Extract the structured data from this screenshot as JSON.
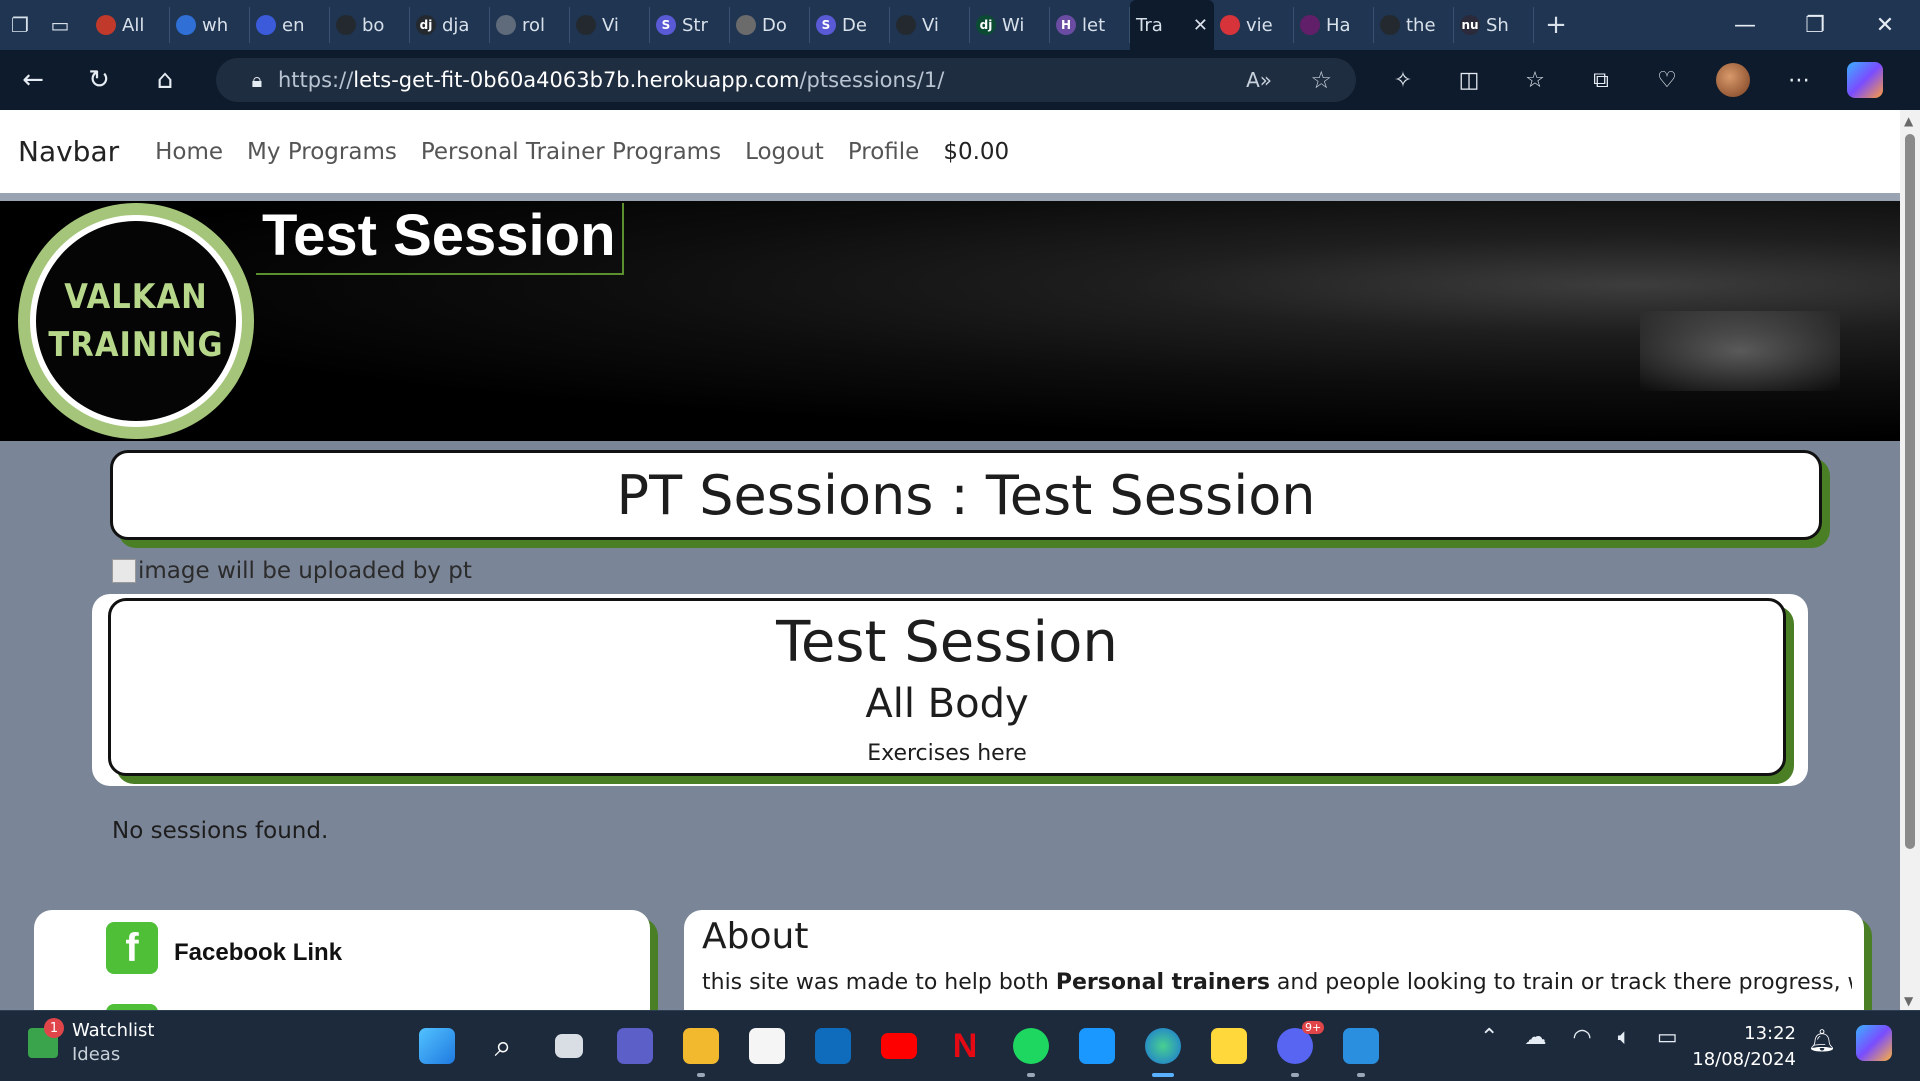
{
  "browser": {
    "tabs": [
      {
        "label": "All",
        "color": "#c0392b"
      },
      {
        "label": "wh",
        "color": "#2f6fd6"
      },
      {
        "label": "en",
        "color": "#3b5bdb"
      },
      {
        "label": "bo",
        "color": "#24292f"
      },
      {
        "label": "dja",
        "color": "#24292f"
      },
      {
        "label": "rol",
        "color": "#5f6b7a"
      },
      {
        "label": "Vi",
        "color": "#24292f"
      },
      {
        "label": "Str",
        "color": "#5a5ad6"
      },
      {
        "label": "Do",
        "color": "#6b6b6b"
      },
      {
        "label": "De",
        "color": "#5a5ad6"
      },
      {
        "label": "Vi",
        "color": "#24292f"
      },
      {
        "label": "Wi",
        "color": "#0c4b33"
      },
      {
        "label": "let",
        "color": "#6a4ca3"
      }
    ],
    "active_tab": {
      "label": "Tra"
    },
    "tabs_after": [
      {
        "label": "vie",
        "color": "#d6333a"
      },
      {
        "label": "Ha",
        "color": "#611f69"
      },
      {
        "label": "the",
        "color": "#24292f"
      },
      {
        "label": "Sh",
        "color": "#2a2a3a"
      }
    ],
    "tab_glyphs": [
      "",
      "",
      "",
      "",
      "dj",
      "",
      "",
      "S",
      "",
      "S",
      "",
      "dj",
      "H"
    ],
    "tab_after_glyphs": [
      "",
      "",
      "",
      "nu"
    ],
    "url_prefix": "https://",
    "url_host": "lets-get-fit-0b60a4063b7b.herokuapp.com",
    "url_path": "/ptsessions/1/"
  },
  "site": {
    "nav": {
      "brand": "Navbar",
      "links": [
        "Home",
        "My Programs",
        "Personal Trainer Programs",
        "Logout",
        "Profile"
      ],
      "cart": "$0.00"
    },
    "hero": {
      "title": "Test Session",
      "logo_line1": "VALKAN",
      "logo_line2": "TRAINING"
    },
    "page_heading": "PT Sessions : Test Session",
    "image_alt": "image will be uploaded by pt",
    "session": {
      "title": "Test Session",
      "type": "All Body",
      "exercises": "Exercises here"
    },
    "no_sessions": "No sessions found.",
    "footer": {
      "facebook": "Facebook Link",
      "about_title": "About",
      "about_text_before": "this site was made to help both ",
      "about_text_bold": "Personal trainers",
      "about_text_after": " and people looking to train or track there progress, we"
    },
    "colors": {
      "accent_green": "#4a7f26",
      "logo_green": "#b7d88a",
      "facebook_green": "#4fbf37"
    }
  },
  "taskbar": {
    "widget_title": "Watchlist",
    "widget_sub": "Ideas",
    "widget_badge": "1",
    "time": "13:22",
    "date": "18/08/2024",
    "discord_badge": "9+"
  }
}
